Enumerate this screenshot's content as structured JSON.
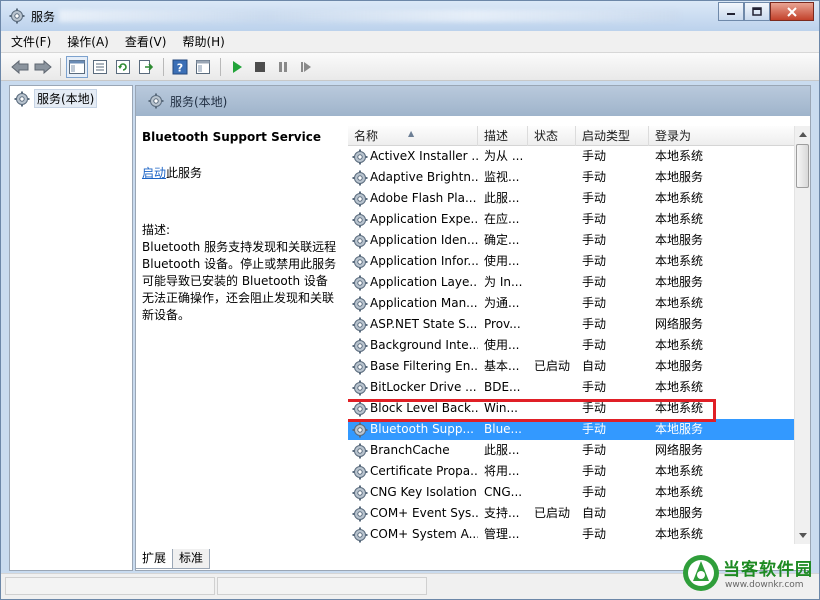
{
  "window": {
    "title": "服务",
    "controls": [
      "minimize-icon",
      "maximize-icon",
      "close-icon"
    ]
  },
  "menu": {
    "items": [
      {
        "label": "文件(F)"
      },
      {
        "label": "操作(A)"
      },
      {
        "label": "查看(V)"
      },
      {
        "label": "帮助(H)"
      }
    ]
  },
  "toolbar": {
    "icons": [
      "back-icon",
      "forward-icon",
      "console-tree-icon",
      "properties-icon",
      "refresh-icon",
      "export-icon",
      "help-icon",
      "view-icon",
      "start-icon",
      "stop-icon",
      "pause-icon",
      "restart-icon"
    ]
  },
  "tree": {
    "root_label": "服务(本地)"
  },
  "pane": {
    "header_label": "服务(本地)"
  },
  "detail": {
    "service_name": "Bluetooth Support Service",
    "start_link": "启动",
    "start_suffix": "此服务",
    "desc_label": "描述:",
    "desc_text": "Bluetooth 服务支持发现和关联远程 Bluetooth 设备。停止或禁用此服务可能导致已安装的 Bluetooth 设备无法正确操作，还会阻止发现和关联新设备。"
  },
  "table": {
    "columns": {
      "name": "名称",
      "desc": "描述",
      "status": "状态",
      "startup": "启动类型",
      "logon": "登录为"
    },
    "selected_index": 13,
    "rows": [
      {
        "name": "ActiveX Installer ...",
        "desc": "为从 ...",
        "status": "",
        "startup": "手动",
        "logon": "本地系统"
      },
      {
        "name": "Adaptive Brightn...",
        "desc": "监视...",
        "status": "",
        "startup": "手动",
        "logon": "本地服务"
      },
      {
        "name": "Adobe Flash Pla...",
        "desc": "此服...",
        "status": "",
        "startup": "手动",
        "logon": "本地系统"
      },
      {
        "name": "Application Expe...",
        "desc": "在应...",
        "status": "",
        "startup": "手动",
        "logon": "本地系统"
      },
      {
        "name": "Application Iden...",
        "desc": "确定...",
        "status": "",
        "startup": "手动",
        "logon": "本地服务"
      },
      {
        "name": "Application Infor...",
        "desc": "使用...",
        "status": "",
        "startup": "手动",
        "logon": "本地系统"
      },
      {
        "name": "Application Laye...",
        "desc": "为 In...",
        "status": "",
        "startup": "手动",
        "logon": "本地服务"
      },
      {
        "name": "Application Man...",
        "desc": "为通...",
        "status": "",
        "startup": "手动",
        "logon": "本地系统"
      },
      {
        "name": "ASP.NET State S...",
        "desc": "Prov...",
        "status": "",
        "startup": "手动",
        "logon": "网络服务"
      },
      {
        "name": "Background Inte...",
        "desc": "使用...",
        "status": "",
        "startup": "手动",
        "logon": "本地系统"
      },
      {
        "name": "Base Filtering En...",
        "desc": "基本...",
        "status": "已启动",
        "startup": "自动",
        "logon": "本地服务"
      },
      {
        "name": "BitLocker Drive ...",
        "desc": "BDE...",
        "status": "",
        "startup": "手动",
        "logon": "本地系统"
      },
      {
        "name": "Block Level Back...",
        "desc": "Win...",
        "status": "",
        "startup": "手动",
        "logon": "本地系统"
      },
      {
        "name": "Bluetooth Supp...",
        "desc": "Blue...",
        "status": "",
        "startup": "手动",
        "logon": "本地服务"
      },
      {
        "name": "BranchCache",
        "desc": "此服...",
        "status": "",
        "startup": "手动",
        "logon": "网络服务"
      },
      {
        "name": "Certificate Propa...",
        "desc": "将用...",
        "status": "",
        "startup": "手动",
        "logon": "本地系统"
      },
      {
        "name": "CNG Key Isolation",
        "desc": "CNG...",
        "status": "",
        "startup": "手动",
        "logon": "本地系统"
      },
      {
        "name": "COM+ Event Sys...",
        "desc": "支持...",
        "status": "已启动",
        "startup": "自动",
        "logon": "本地服务"
      },
      {
        "name": "COM+ System A...",
        "desc": "管理...",
        "status": "",
        "startup": "手动",
        "logon": "本地系统"
      }
    ]
  },
  "tabs": [
    {
      "label": "扩展"
    },
    {
      "label": "标准"
    }
  ],
  "watermark": {
    "name": "当客软件园",
    "url": "www.downkr.com"
  },
  "colors": {
    "selection": "#3399ff",
    "highlight_box": "#e01f26",
    "link": "#1c64c6",
    "pane_header": "#a9bdd4"
  }
}
